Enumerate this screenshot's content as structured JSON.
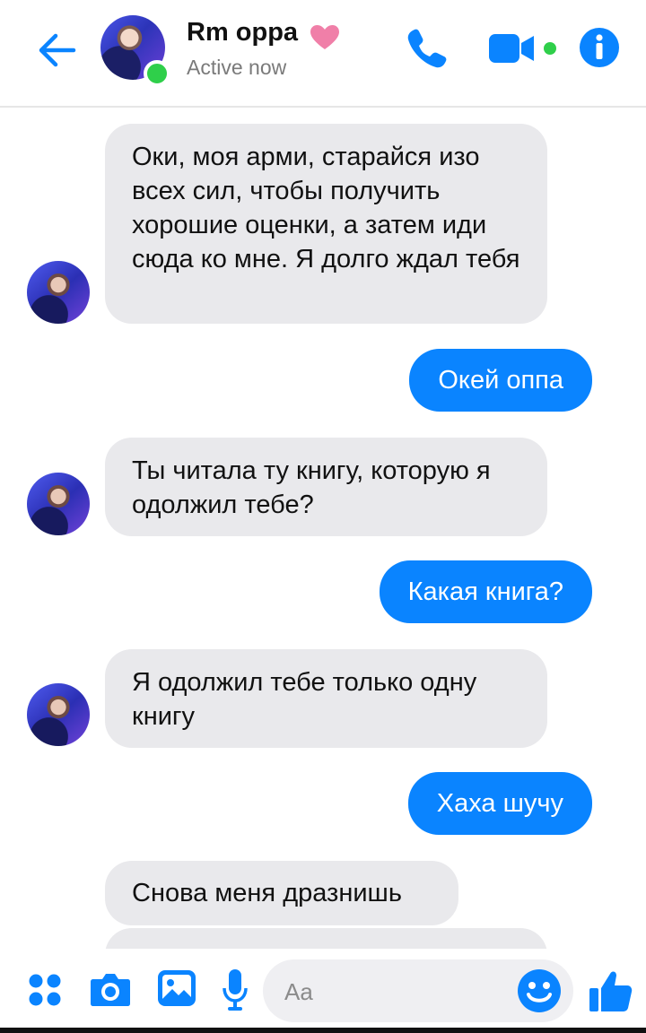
{
  "header": {
    "contact_name": "Rm oppa",
    "status": "Active now"
  },
  "colors": {
    "accent": "#0a84ff",
    "incoming_bubble": "#e9e9ec",
    "online": "#2fcf4a",
    "heart": "#f07fa8"
  },
  "messages": [
    {
      "direction": "in",
      "text": "Оки, моя арми, старайся изо всех сил, чтобы получить хорошие оценки, а затем иди сюда ко мне. Я долго ждал тебя"
    },
    {
      "direction": "out",
      "text": "Окей оппа"
    },
    {
      "direction": "in",
      "text": "Ты читала ту книгу, которую я одолжил тебе?"
    },
    {
      "direction": "out",
      "text": "Какая книга?"
    },
    {
      "direction": "in",
      "text": "Я одолжил тебе только одну книгу"
    },
    {
      "direction": "out",
      "text": "Хаха шучу"
    },
    {
      "direction": "in",
      "text": "Снова меня дразнишь"
    }
  ],
  "composer": {
    "placeholder": "Aa",
    "icons": [
      "menu-dots-icon",
      "camera-icon",
      "gallery-icon",
      "microphone-icon",
      "emoji-icon",
      "thumbs-up-icon"
    ]
  }
}
